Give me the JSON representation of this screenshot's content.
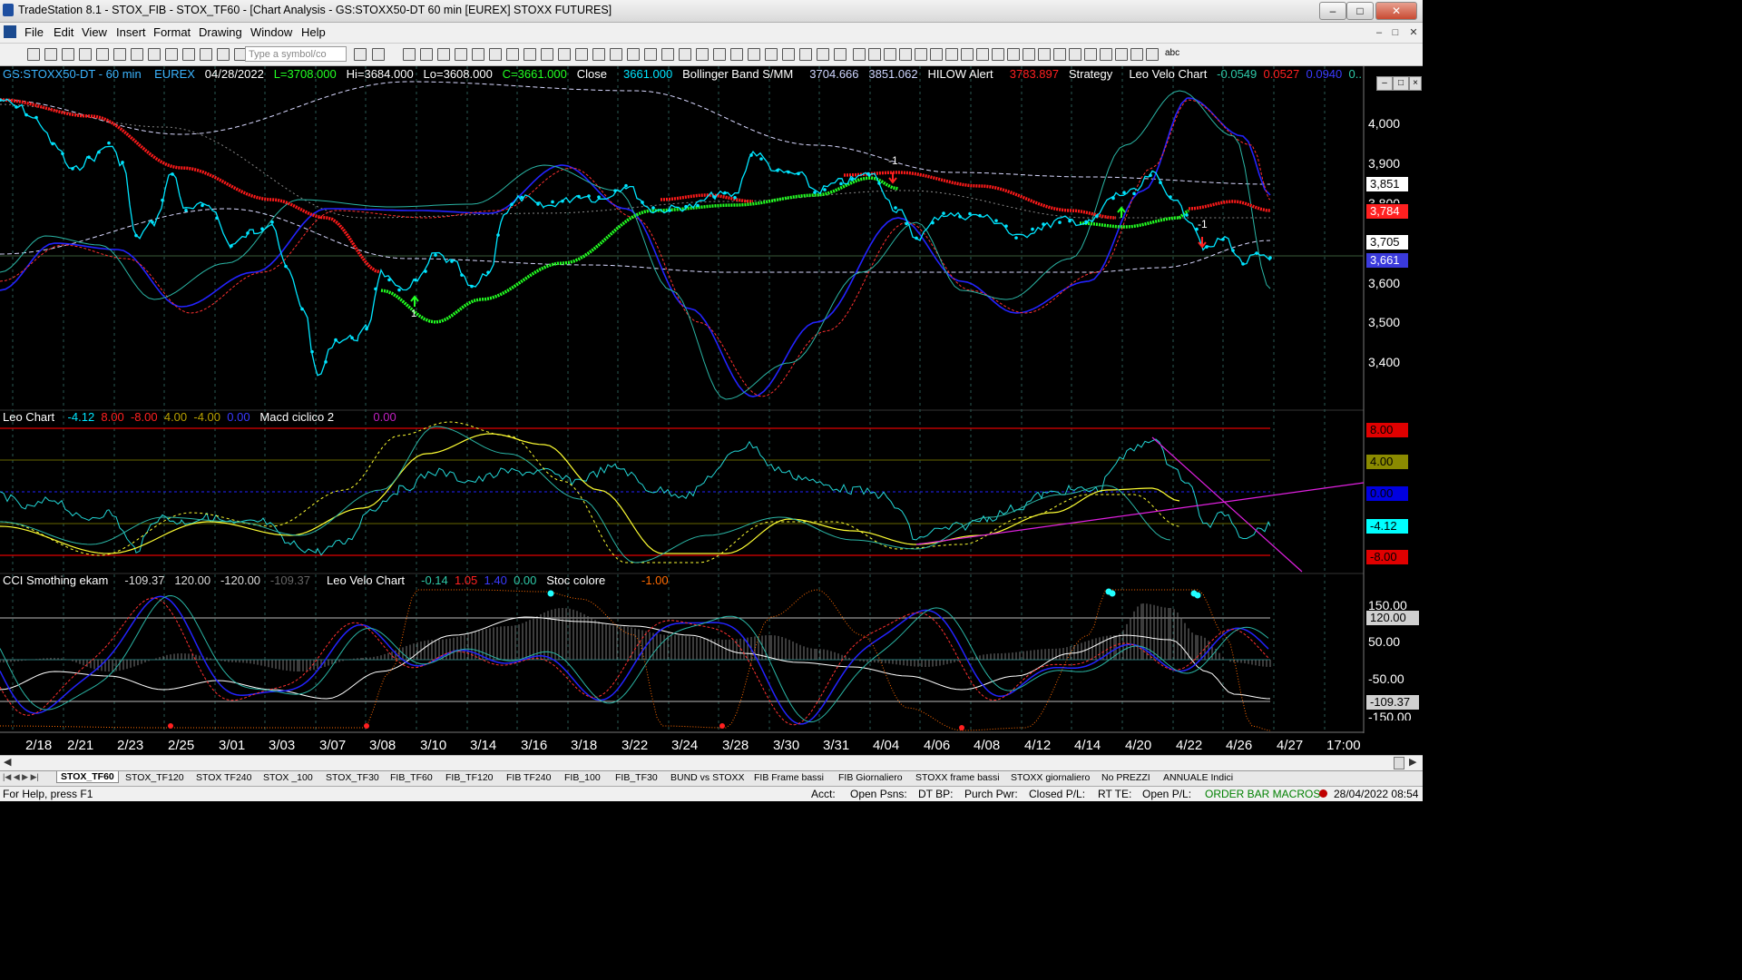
{
  "window": {
    "title": "TradeStation 8.1 - STOX_FIB - STOX_TF60 - [Chart Analysis - GS:STOXX50-DT  60 min  [EUREX] STOXX FUTURES]"
  },
  "menu": [
    "File",
    "Edit",
    "View",
    "Insert",
    "Format",
    "Drawing",
    "Window",
    "Help"
  ],
  "toolbar": {
    "symbol_placeholder": "Type a symbol/co",
    "text_tool": "abc"
  },
  "header": {
    "symbol": "GS:STOXX50-DT - 60 min",
    "exchange": "EUREX",
    "date": "04/28/2022",
    "last": "L=3708.000",
    "hi": "Hi=3684.000",
    "lo": "Lo=3608.000",
    "close_val": "C=3661.000",
    "close_lbl": "Close",
    "close_num": "3661.000",
    "bb_lbl": "Bollinger Band S/MM",
    "bb1": "3704.666",
    "bb2": "3851.062",
    "hilow_lbl": "HILOW Alert",
    "hilow_val": "3783.897",
    "strategy": "Strategy",
    "leo_velo": "Leo Velo Chart",
    "lv1": "-0.0549",
    "lv2": "0.0527",
    "lv3": "0.0940",
    "lv4": "0.."
  },
  "panel2_header": {
    "name": "Leo Chart",
    "v1": "-4.12",
    "v2": "8.00",
    "v3": "-8.00",
    "v4": "4.00",
    "v5": "-4.00",
    "v6": "0.00",
    "macd": "Macd ciclico 2",
    "macd_v": "0.00"
  },
  "panel3_header": {
    "name": "CCI Smothing ekam",
    "v1": "-109.37",
    "v2": "120.00",
    "v3": "-120.00",
    "v4": "-109.37",
    "leo": "Leo Velo Chart",
    "l1": "-0.14",
    "l2": "1.05",
    "l3": "1.40",
    "l4": "0.00",
    "stoc": "Stoc colore",
    "s1": "-1.00"
  },
  "price_axis": {
    "ticks": [
      "4,000",
      "3,900",
      "3,800",
      "3,600",
      "3,500",
      "3,400"
    ],
    "labels": [
      {
        "text": "3,851",
        "bg": "#ffffff",
        "fg": "#000000"
      },
      {
        "text": "3,784",
        "bg": "#ff2020",
        "fg": "#ffffff"
      },
      {
        "text": "3,705",
        "bg": "#ffffff",
        "fg": "#000000"
      },
      {
        "text": "3,661",
        "bg": "#3a3adc",
        "fg": "#ffffff"
      }
    ]
  },
  "panel2_axis": [
    {
      "text": "8.00",
      "bg": "#e00000",
      "fg": "#000"
    },
    {
      "text": "4.00",
      "bg": "#8a8a00",
      "fg": "#000"
    },
    {
      "text": "0.00",
      "bg": "#0000e0",
      "fg": "#000"
    },
    {
      "text": "-4.12",
      "bg": "#00ffff",
      "fg": "#000"
    },
    {
      "text": "-8.00",
      "bg": "#e00000",
      "fg": "#000"
    }
  ],
  "panel3_axis": {
    "ticks": [
      "150.00",
      "50.00",
      "-50.00",
      "-150.00"
    ],
    "labels": [
      {
        "text": "120.00",
        "bg": "#d0d0d0",
        "fg": "#000"
      },
      {
        "text": "-109.37",
        "bg": "#d0d0d0",
        "fg": "#000"
      }
    ]
  },
  "x_axis": [
    "2/18",
    "2/21",
    "2/23",
    "2/25",
    "3/01",
    "3/03",
    "3/07",
    "3/08",
    "3/10",
    "3/14",
    "3/16",
    "3/18",
    "3/22",
    "3/24",
    "3/28",
    "3/30",
    "3/31",
    "4/04",
    "4/06",
    "4/08",
    "4/12",
    "4/14",
    "4/20",
    "4/22",
    "4/26",
    "4/27",
    "17:00"
  ],
  "markers": {
    "m1": "-1",
    "m2": "-1",
    "m3": "1"
  },
  "tabs": [
    "STOX_TF60",
    "STOX_TF120",
    "STOX TF240",
    "STOX _100",
    "STOX_TF30",
    "FIB_TF60",
    "FIB_TF120",
    "FIB TF240",
    "FIB_100",
    "FIB_TF30",
    "BUND vs STOXX",
    "FIB Frame bassi",
    "FIB Giornaliero",
    "STOXX frame bassi",
    "STOXX giornaliero",
    "No PREZZI",
    "ANNUALE Indici"
  ],
  "status": {
    "help": "For Help, press F1",
    "acct": "Acct:",
    "open_psns": "Open Psns:",
    "dt_bp": "DT BP:",
    "purch_pwr": "Purch Pwr:",
    "closed_pl": "Closed P/L:",
    "rt_te": "RT TE:",
    "open_pl": "Open P/L:",
    "order_bar": "ORDER BAR  MACROS",
    "datetime": "28/04/2022 08:54"
  },
  "colors": {
    "price": "#00e5ff",
    "ma_red": "#ff1a1a",
    "ma_green": "#1aff1a",
    "cyan": "#00e5ff",
    "yellow": "#ffff33",
    "magenta": "#e020e0",
    "blue": "#2020ff"
  }
}
